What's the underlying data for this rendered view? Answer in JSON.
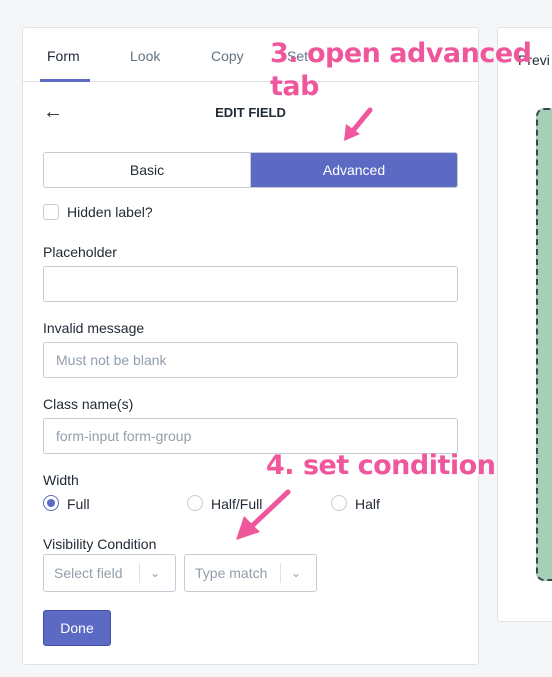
{
  "tabs": [
    "Form",
    "Look",
    "Copy",
    "Set"
  ],
  "preview_label": "Previ",
  "edit_field": {
    "title": "EDIT FIELD",
    "back_icon": "←",
    "segments": {
      "basic": "Basic",
      "advanced": "Advanced"
    },
    "hidden_label": "Hidden label?",
    "placeholder": {
      "label": "Placeholder",
      "value": ""
    },
    "invalid_message": {
      "label": "Invalid message",
      "placeholder": "Must not be blank"
    },
    "class_names": {
      "label": "Class name(s)",
      "placeholder": "form-input form-group"
    },
    "width": {
      "label": "Width",
      "options": [
        "Full",
        "Half/Full",
        "Half"
      ],
      "selected": "Full"
    },
    "visibility": {
      "label": "Visibility Condition",
      "field_placeholder": "Select field",
      "match_placeholder": "Type match"
    },
    "done_label": "Done"
  },
  "annotations": {
    "step3_line1": "3. open advanced",
    "step3_line2": "tab",
    "step4": "4. set condition"
  },
  "colors": {
    "accent": "#5c6ac4",
    "annotation": "#f0569c",
    "preview_fill": "#a6cfb8"
  }
}
